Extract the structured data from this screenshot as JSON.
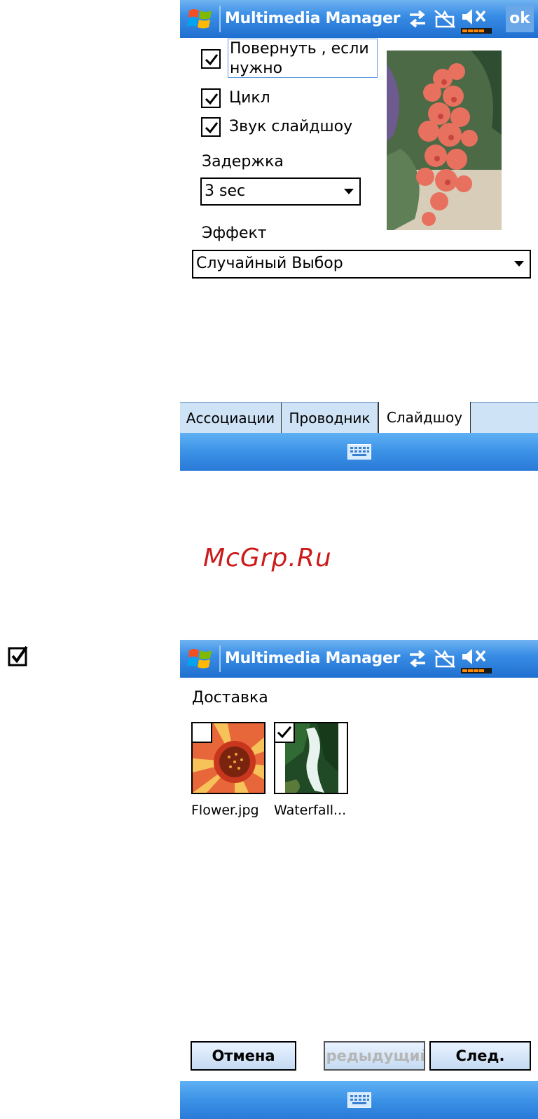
{
  "top_screen": {
    "title": "Multimedia Manager",
    "ok_label": "ok",
    "status_icons": [
      "windows-start-icon",
      "sync-arrows-icon",
      "no-signal-icon",
      "volume-mute-icon",
      "battery-icon"
    ],
    "options": [
      {
        "label": "Повернуть , если нужно",
        "checked": true
      },
      {
        "label": "Цикл",
        "checked": true
      },
      {
        "label": "Звук слайдшоу",
        "checked": true
      }
    ],
    "delay_label": "Задержка",
    "delay_value": "3 sec",
    "effect_label": "Эффект",
    "effect_value": "Случайный Выбор",
    "tabs": [
      {
        "label": "Ассоциации",
        "active": false
      },
      {
        "label": "Проводник",
        "active": false
      },
      {
        "label": "Слайдшоу",
        "active": true
      }
    ]
  },
  "watermark": "McGrp.Ru",
  "bottom_screen": {
    "title": "Multimedia Manager",
    "section_label": "Доставка",
    "files": [
      {
        "name": "Flower.jpg",
        "checked": false
      },
      {
        "name": "Waterfall...",
        "checked": true
      }
    ],
    "buttons": {
      "cancel": "Отмена",
      "previous": "Предыдущий",
      "next": "След."
    }
  },
  "colors": {
    "titlebar": "#2f84e0",
    "bottombar": "#3b92e6",
    "tab_strip": "#cfe3f7",
    "watermark": "#cc1a1a"
  }
}
